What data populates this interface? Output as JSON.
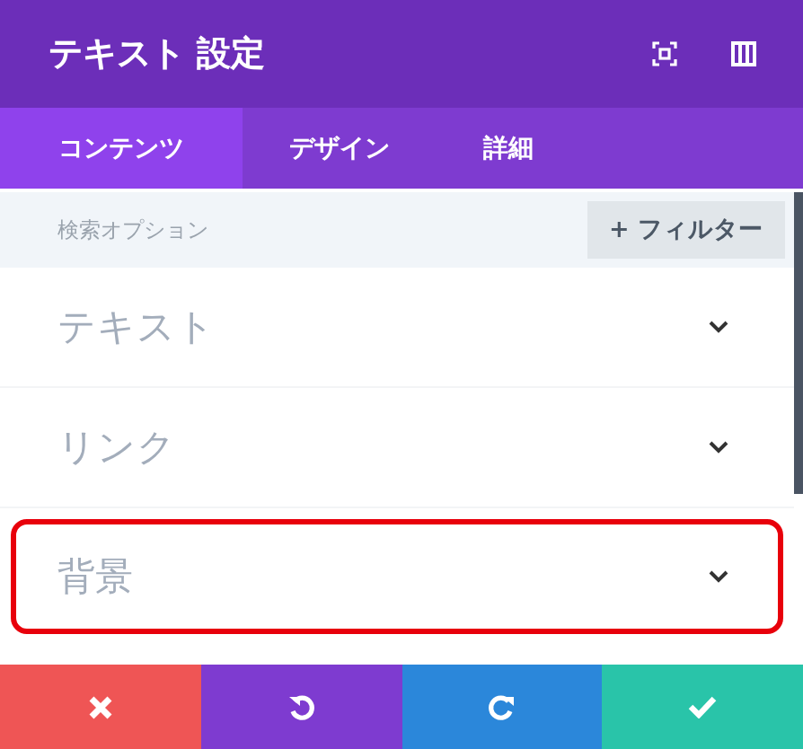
{
  "header": {
    "title": "テキスト 設定"
  },
  "tabs": [
    {
      "label": "コンテンツ",
      "selected": true
    },
    {
      "label": "デザイン",
      "selected": false
    },
    {
      "label": "詳細",
      "selected": false
    }
  ],
  "search": {
    "placeholder": "検索オプション",
    "filter_button": "+ フィルター"
  },
  "sections": [
    {
      "label": "テキスト",
      "highlighted": false
    },
    {
      "label": "リンク",
      "highlighted": false
    },
    {
      "label": "背景",
      "highlighted": true
    }
  ],
  "actions": [
    {
      "kind": "cancel"
    },
    {
      "kind": "undo"
    },
    {
      "kind": "redo"
    },
    {
      "kind": "save"
    }
  ]
}
